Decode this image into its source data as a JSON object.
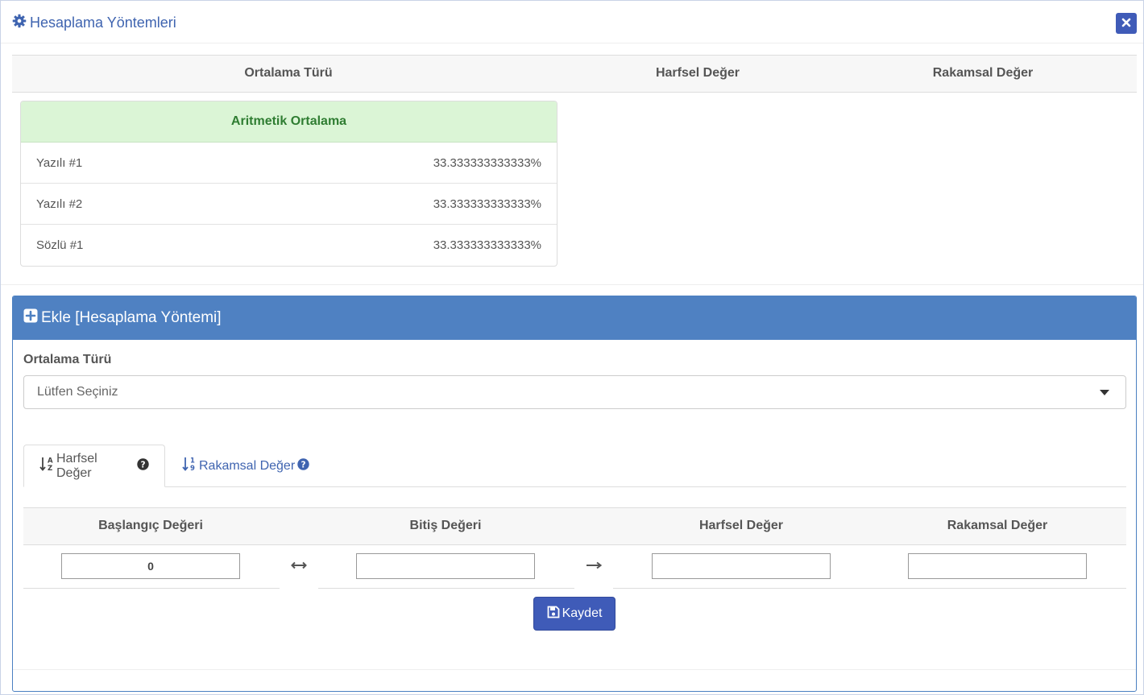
{
  "window": {
    "title": "Hesaplama Yöntemleri",
    "title_icon": "gear-icon",
    "close_icon": "close-icon"
  },
  "summary": {
    "columns": [
      "Ortalama Türü",
      "Harfsel Değer",
      "Rakamsal Değer"
    ],
    "card": {
      "title": "Aritmetik Ortalama",
      "rows": [
        {
          "name": "Yazılı #1",
          "value": "33.333333333333%"
        },
        {
          "name": "Yazılı #2",
          "value": "33.333333333333%"
        },
        {
          "name": "Sözlü #1",
          "value": "33.333333333333%"
        }
      ]
    }
  },
  "add_panel": {
    "title": "Ekle [Hesaplama Yöntemi]",
    "title_icon": "plus-square-icon",
    "type_label": "Ortalama Türü",
    "select_value": "Lütfen Seçiniz",
    "tabs": [
      {
        "label": "Harfsel Değer",
        "icon": "sort-alpha-icon",
        "active": true
      },
      {
        "label": "Rakamsal Değer",
        "icon": "sort-numeric-icon",
        "active": false
      }
    ],
    "range_columns": [
      "Başlangıç Değeri",
      "Bitiş Değeri",
      "Harfsel Değer",
      "Rakamsal Değer"
    ],
    "inputs": {
      "start": "0",
      "end": "",
      "letter": "",
      "number": ""
    },
    "save_label": "Kaydet",
    "save_icon": "floppy-disk-icon"
  },
  "colors": {
    "primary": "#3f5bb8",
    "panel_header": "#4f81c2",
    "success_bg": "#dbf5d6",
    "success_text": "#2f7d32",
    "link": "#3f64b0"
  }
}
